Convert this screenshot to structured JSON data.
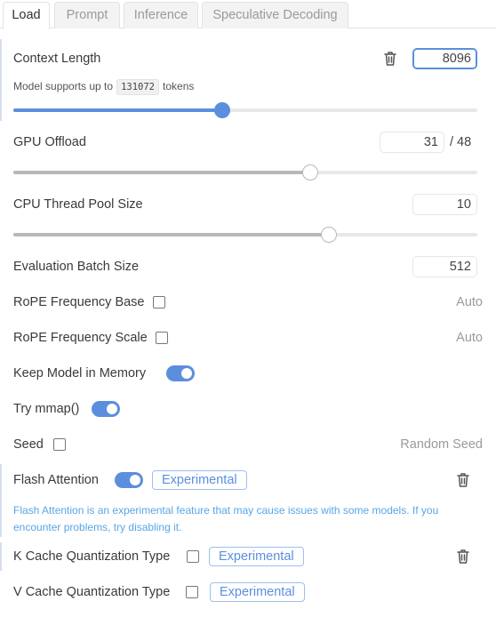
{
  "tabs": [
    {
      "label": "Load",
      "active": true
    },
    {
      "label": "Prompt",
      "active": false
    },
    {
      "label": "Inference",
      "active": false
    },
    {
      "label": "Speculative Decoding",
      "active": false
    }
  ],
  "context_length": {
    "label": "Context Length",
    "value": "8096",
    "support_prefix": "Model supports up to",
    "support_max": "131072",
    "support_suffix": "tokens",
    "slider_fraction": 0.45
  },
  "gpu_offload": {
    "label": "GPU Offload",
    "value": "31",
    "max": "/ 48",
    "slider_fraction": 0.64
  },
  "cpu_threads": {
    "label": "CPU Thread Pool Size",
    "value": "10",
    "slider_fraction": 0.68
  },
  "eval_batch": {
    "label": "Evaluation Batch Size",
    "value": "512"
  },
  "rope_base": {
    "label": "RoPE Frequency Base",
    "checked": false,
    "value": "Auto"
  },
  "rope_scale": {
    "label": "RoPE Frequency Scale",
    "checked": false,
    "value": "Auto"
  },
  "keep_in_memory": {
    "label": "Keep Model in Memory",
    "on": true
  },
  "mmap": {
    "label": "Try mmap()",
    "on": true
  },
  "seed": {
    "label": "Seed",
    "checked": false,
    "value": "Random Seed"
  },
  "flash_attention": {
    "label": "Flash Attention",
    "on": true,
    "badge": "Experimental",
    "warning": "Flash Attention is an experimental feature that may cause issues with some models. If you encounter problems, try disabling it."
  },
  "k_cache": {
    "label": "K Cache Quantization Type",
    "checked": false,
    "badge": "Experimental"
  },
  "v_cache": {
    "label": "V Cache Quantization Type",
    "checked": false,
    "badge": "Experimental"
  },
  "colors": {
    "accent": "#5b8fde",
    "slider_blue": "#5b8fde",
    "slider_gray": "#b8b8b8",
    "warning_text": "#58a6e7",
    "muted_text": "#9a9a9a"
  },
  "icons": [
    "trash-icon"
  ]
}
